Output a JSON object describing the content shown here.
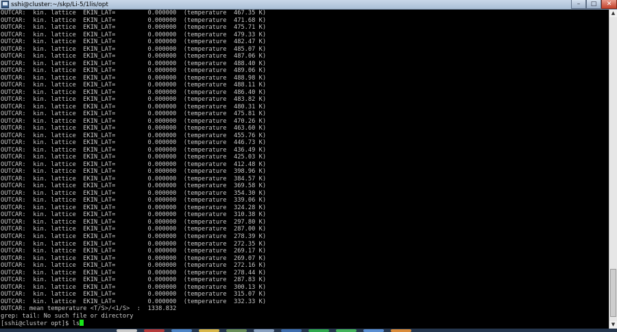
{
  "window": {
    "title": "sshi@cluster:~/skp/Li-5/1lis/opt",
    "min_glyph": "–",
    "max_glyph": "□",
    "close_glyph": "✕"
  },
  "terminal": {
    "lines": [
      "OUTCAR:  kin. lattice  EKIN_LAT=         0.000000  (temperature  467.35 K)",
      "OUTCAR:  kin. lattice  EKIN_LAT=         0.000000  (temperature  471.68 K)",
      "OUTCAR:  kin. lattice  EKIN_LAT=         0.000000  (temperature  475.71 K)",
      "OUTCAR:  kin. lattice  EKIN_LAT=         0.000000  (temperature  479.33 K)",
      "OUTCAR:  kin. lattice  EKIN_LAT=         0.000000  (temperature  482.47 K)",
      "OUTCAR:  kin. lattice  EKIN_LAT=         0.000000  (temperature  485.07 K)",
      "OUTCAR:  kin. lattice  EKIN_LAT=         0.000000  (temperature  487.06 K)",
      "OUTCAR:  kin. lattice  EKIN_LAT=         0.000000  (temperature  488.40 K)",
      "OUTCAR:  kin. lattice  EKIN_LAT=         0.000000  (temperature  489.06 K)",
      "OUTCAR:  kin. lattice  EKIN_LAT=         0.000000  (temperature  488.98 K)",
      "OUTCAR:  kin. lattice  EKIN_LAT=         0.000000  (temperature  488.11 K)",
      "OUTCAR:  kin. lattice  EKIN_LAT=         0.000000  (temperature  486.40 K)",
      "OUTCAR:  kin. lattice  EKIN_LAT=         0.000000  (temperature  483.82 K)",
      "OUTCAR:  kin. lattice  EKIN_LAT=         0.000000  (temperature  480.31 K)",
      "OUTCAR:  kin. lattice  EKIN_LAT=         0.000000  (temperature  475.81 K)",
      "OUTCAR:  kin. lattice  EKIN_LAT=         0.000000  (temperature  470.26 K)",
      "OUTCAR:  kin. lattice  EKIN_LAT=         0.000000  (temperature  463.60 K)",
      "OUTCAR:  kin. lattice  EKIN_LAT=         0.000000  (temperature  455.76 K)",
      "OUTCAR:  kin. lattice  EKIN_LAT=         0.000000  (temperature  446.73 K)",
      "OUTCAR:  kin. lattice  EKIN_LAT=         0.000000  (temperature  436.49 K)",
      "OUTCAR:  kin. lattice  EKIN_LAT=         0.000000  (temperature  425.03 K)",
      "OUTCAR:  kin. lattice  EKIN_LAT=         0.000000  (temperature  412.48 K)",
      "OUTCAR:  kin. lattice  EKIN_LAT=         0.000000  (temperature  398.96 K)",
      "OUTCAR:  kin. lattice  EKIN_LAT=         0.000000  (temperature  384.57 K)",
      "OUTCAR:  kin. lattice  EKIN_LAT=         0.000000  (temperature  369.58 K)",
      "OUTCAR:  kin. lattice  EKIN_LAT=         0.000000  (temperature  354.30 K)",
      "OUTCAR:  kin. lattice  EKIN_LAT=         0.000000  (temperature  339.06 K)",
      "OUTCAR:  kin. lattice  EKIN_LAT=         0.000000  (temperature  324.28 K)",
      "OUTCAR:  kin. lattice  EKIN_LAT=         0.000000  (temperature  310.38 K)",
      "OUTCAR:  kin. lattice  EKIN_LAT=         0.000000  (temperature  297.80 K)",
      "OUTCAR:  kin. lattice  EKIN_LAT=         0.000000  (temperature  287.00 K)",
      "OUTCAR:  kin. lattice  EKIN_LAT=         0.000000  (temperature  278.39 K)",
      "OUTCAR:  kin. lattice  EKIN_LAT=         0.000000  (temperature  272.35 K)",
      "OUTCAR:  kin. lattice  EKIN_LAT=         0.000000  (temperature  269.17 K)",
      "OUTCAR:  kin. lattice  EKIN_LAT=         0.000000  (temperature  269.07 K)",
      "OUTCAR:  kin. lattice  EKIN_LAT=         0.000000  (temperature  272.16 K)",
      "OUTCAR:  kin. lattice  EKIN_LAT=         0.000000  (temperature  278.44 K)",
      "OUTCAR:  kin. lattice  EKIN_LAT=         0.000000  (temperature  287.83 K)",
      "OUTCAR:  kin. lattice  EKIN_LAT=         0.000000  (temperature  300.13 K)",
      "OUTCAR:  kin. lattice  EKIN_LAT=         0.000000  (temperature  315.07 K)",
      "OUTCAR:  kin. lattice  EKIN_LAT=         0.000000  (temperature  332.33 K)",
      "OUTCAR: mean temperature <T/S>/<1/S>  :  1338.832",
      "grep: tail: No such file or directory"
    ],
    "prompt": "[sshi@cluster opt]$ ",
    "command": "ls",
    "cursor_color": "#19e619",
    "text_color": "#c9c9c9",
    "background": "#000000"
  },
  "scrollbar": {
    "up_glyph": "▲",
    "down_glyph": "▼"
  }
}
